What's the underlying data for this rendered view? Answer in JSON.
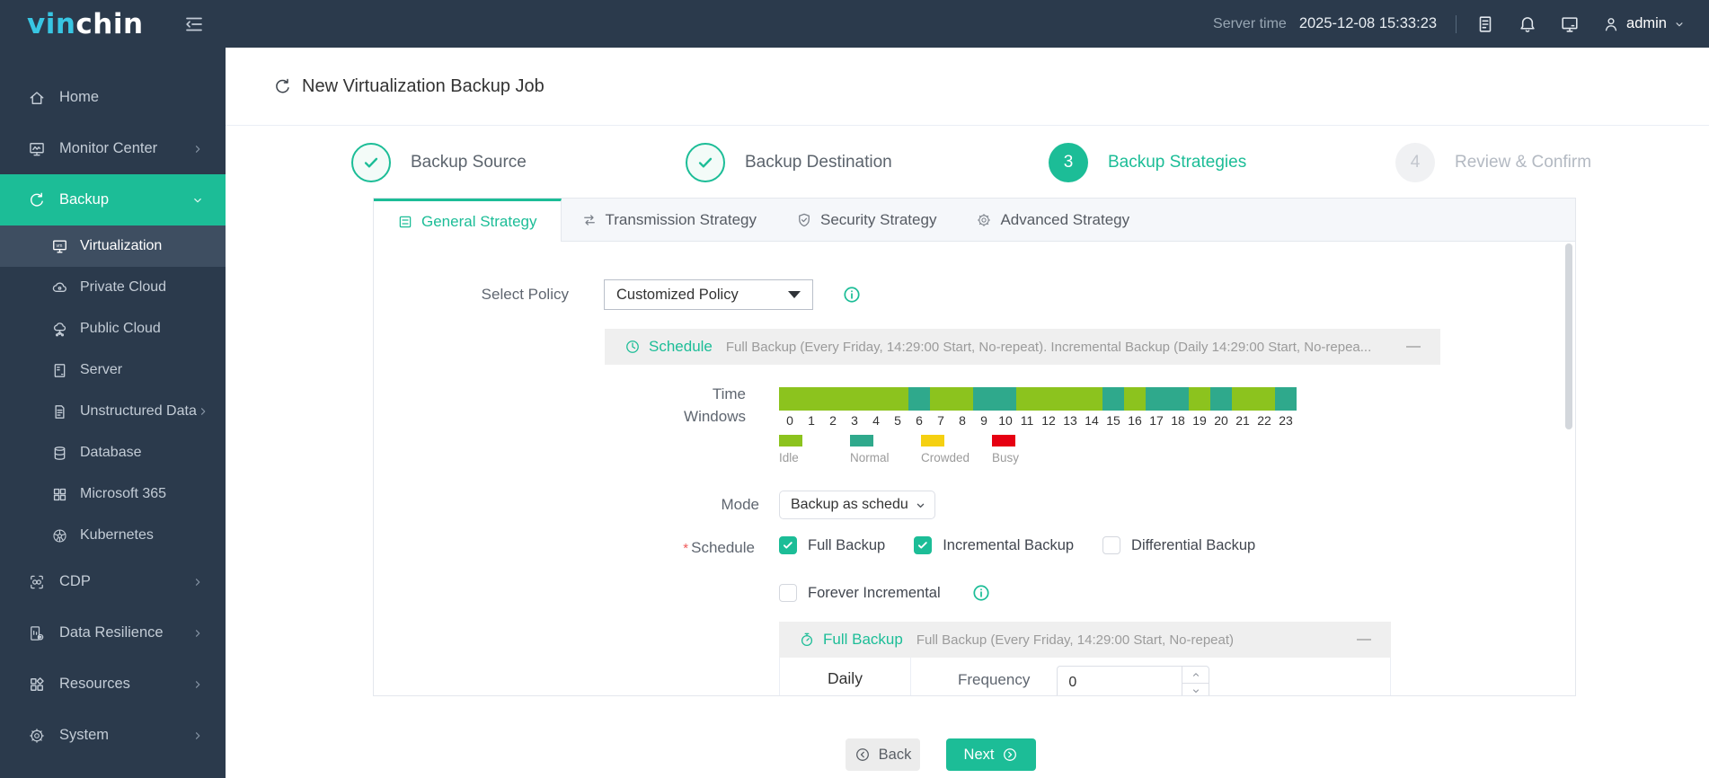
{
  "topbar": {
    "logo_part1": "vin",
    "logo_part2": "chin",
    "server_time_label": "Server time",
    "server_time_value": "2025-12-08 15:33:23",
    "user": "admin"
  },
  "sidebar": {
    "items": [
      {
        "label": "Home",
        "icon": "home-icon"
      },
      {
        "label": "Monitor Center",
        "icon": "monitor-center-icon",
        "chevron": "right"
      },
      {
        "label": "Backup",
        "icon": "backup-icon",
        "chevron": "down",
        "active": true
      },
      {
        "label": "Virtualization",
        "icon": "virtualization-icon",
        "sub": true,
        "selected": true
      },
      {
        "label": "Private Cloud",
        "icon": "private-cloud-icon",
        "sub": true
      },
      {
        "label": "Public Cloud",
        "icon": "public-cloud-icon",
        "sub": true
      },
      {
        "label": "Server",
        "icon": "server-icon",
        "sub": true
      },
      {
        "label": "Unstructured Data",
        "icon": "unstructured-data-icon",
        "sub": true,
        "chevron": "right"
      },
      {
        "label": "Database",
        "icon": "database-icon",
        "sub": true
      },
      {
        "label": "Microsoft 365",
        "icon": "microsoft-365-icon",
        "sub": true
      },
      {
        "label": "Kubernetes",
        "icon": "kubernetes-icon",
        "sub": true
      },
      {
        "label": "CDP",
        "icon": "cdp-icon",
        "chevron": "right"
      },
      {
        "label": "Data Resilience",
        "icon": "data-resilience-icon",
        "chevron": "right"
      },
      {
        "label": "Resources",
        "icon": "resources-icon",
        "chevron": "right"
      },
      {
        "label": "System",
        "icon": "system-icon",
        "chevron": "right"
      }
    ]
  },
  "page": {
    "title": "New Virtualization Backup Job"
  },
  "steps": [
    {
      "label": "Backup Source",
      "state": "done"
    },
    {
      "label": "Backup Destination",
      "state": "done"
    },
    {
      "label": "Backup Strategies",
      "number": "3",
      "state": "active"
    },
    {
      "label": "Review & Confirm",
      "number": "4",
      "state": "pending"
    }
  ],
  "tabs": [
    {
      "label": "General Strategy",
      "icon": "list",
      "active": true
    },
    {
      "label": "Transmission Strategy",
      "icon": "transfer",
      "active": false
    },
    {
      "label": "Security Strategy",
      "icon": "shield",
      "active": false
    },
    {
      "label": "Advanced Strategy",
      "icon": "gear",
      "active": false
    }
  ],
  "form": {
    "select_policy": {
      "label": "Select Policy",
      "value": "Customized Policy"
    },
    "schedule_panel": {
      "title": "Schedule",
      "summary": "Full Backup (Every Friday, 14:29:00 Start, No-repeat). Incremental Backup (Daily 14:29:00 Start, No-repea...",
      "collapse": "—"
    },
    "time_windows": {
      "label_line1": "Time",
      "label_line2": "Windows",
      "hours": [
        "0",
        "1",
        "2",
        "3",
        "4",
        "5",
        "6",
        "7",
        "8",
        "9",
        "10",
        "11",
        "12",
        "13",
        "14",
        "15",
        "16",
        "17",
        "18",
        "19",
        "20",
        "21",
        "22",
        "23"
      ],
      "statuses": [
        "idle",
        "idle",
        "idle",
        "idle",
        "idle",
        "idle",
        "normal",
        "idle",
        "idle",
        "normal",
        "normal",
        "idle",
        "idle",
        "idle",
        "idle",
        "normal",
        "idle",
        "normal",
        "normal",
        "idle",
        "normal",
        "idle",
        "idle",
        "normal"
      ],
      "legend": [
        {
          "label": "Idle",
          "status": "idle"
        },
        {
          "label": "Normal",
          "status": "normal"
        },
        {
          "label": "Crowded",
          "status": "crowded"
        },
        {
          "label": "Busy",
          "status": "busy"
        }
      ]
    },
    "mode": {
      "label": "Mode",
      "value": "Backup as schedu"
    },
    "schedule": {
      "required_mark": "*",
      "label": "Schedule",
      "options": [
        {
          "label": "Full Backup",
          "checked": true
        },
        {
          "label": "Incremental Backup",
          "checked": true
        },
        {
          "label": "Differential Backup",
          "checked": false
        }
      ],
      "forever_incremental_label": "Forever Incremental"
    },
    "full_backup_panel": {
      "title": "Full Backup",
      "summary": "Full Backup (Every Friday, 14:29:00 Start, No-repeat)",
      "collapse": "—",
      "period": "Daily",
      "frequency_label": "Frequency",
      "frequency_value": "0"
    }
  },
  "footer": {
    "back_label": "Back",
    "next_label": "Next"
  },
  "colors": {
    "accent": "#1cbd97",
    "sidebar_bg": "#2b3a4c",
    "idle": "#8cc31e",
    "normal": "#2fa98c",
    "crowded": "#f5d011",
    "busy": "#e60012",
    "notification_badge": "#f4606c"
  }
}
